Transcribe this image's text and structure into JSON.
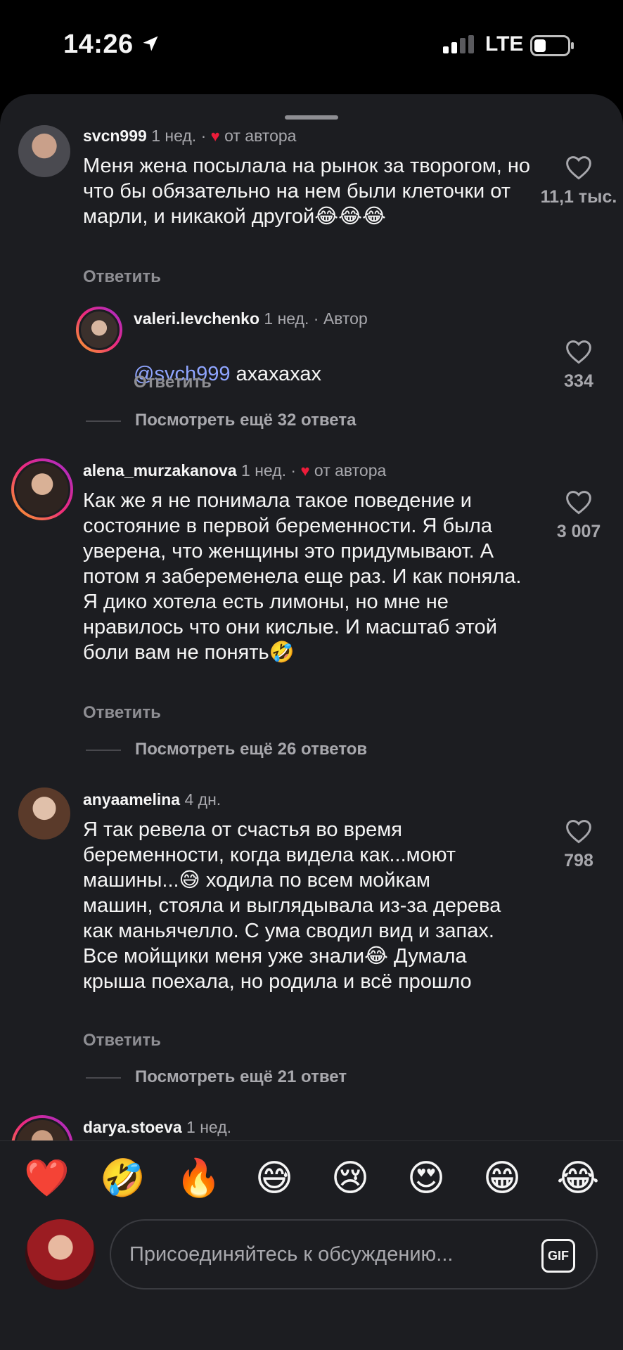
{
  "status_bar": {
    "time": "14:26",
    "network": "LTE"
  },
  "comments": [
    {
      "username": "svch999",
      "username_visible": "svcn999",
      "age": "1 нед.",
      "separator": "·",
      "badge": "от автора",
      "text": "Меня жена посылала на рынок за творогом, но что бы обязательно на нем были клеточки от марли, и никакой другой😂😂😂",
      "likes": "11,1 тыс.",
      "reply_label": "Ответить"
    },
    {
      "username": "valeri.levchenko",
      "age": "1 нед.",
      "separator": "·",
      "badge": "Автор",
      "mention": "@svch999",
      "text": " ахахахах",
      "likes": "334",
      "reply_label": "Ответить",
      "more_replies": "Посмотреть ещё 32 ответа"
    },
    {
      "username": "alena_murzakanova",
      "age": "1 нед.",
      "separator": "·",
      "badge": "от автора",
      "text": "Как же я не понимала такое поведение и состояние в первой беременности. Я была уверена, что женщины это придумывают. А потом я забеременела еще раз. И как поняла.  Я дико хотела есть лимоны, но мне не нравилось что они кислые. И масштаб этой боли вам не понять🤣",
      "likes": "3 007",
      "reply_label": "Ответить",
      "more_replies": "Посмотреть ещё 26 ответов"
    },
    {
      "username": "anyaamelina",
      "age": "4 дн.",
      "text": "Я так ревела от счастья во время беременности, когда видела как...моют машины...😅 ходила по всем мойкам машин, стояла и выглядывала из-за дерева как маньячелло. С ума сводил вид и запах. Все мойщики меня уже знали😂 Думала крыша поехала, но родила и всё прошло",
      "likes": "798",
      "reply_label": "Ответить",
      "more_replies": "Посмотреть ещё 21 ответ"
    },
    {
      "username": "darya.stoeva",
      "age": "1 нед."
    }
  ],
  "emoji_bar": [
    "❤️",
    "🤣",
    "🔥",
    "😅",
    "😢",
    "😍",
    "😁",
    "😂"
  ],
  "composer": {
    "placeholder": "Присоединяйтесь к обсуждению...",
    "gif_label": "GIF"
  },
  "colors": {
    "sheet_bg": "#1c1d21",
    "heart_red": "#ed1c3a",
    "mention_blue": "#8fa5ff",
    "muted_text": "#a8a8ad"
  }
}
